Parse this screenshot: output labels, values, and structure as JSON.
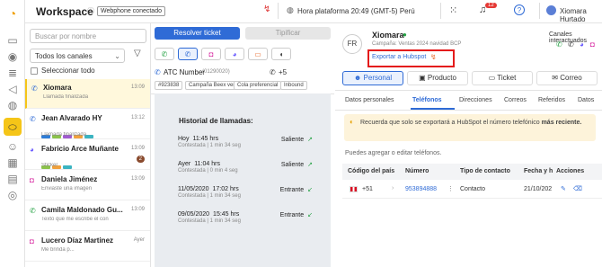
{
  "header": {
    "title": "Workspace",
    "status_badge": "Webphone conectado",
    "clock": "Hora plataforma 20:49 (GMT-5) Perú",
    "notifications_count": "12",
    "user_name": "Xiomara Hurtado"
  },
  "sidebar": {
    "search_placeholder": "Buscar por nombre",
    "channel_filter": "Todos los canales",
    "select_all": "Seleccionar todo",
    "conversations": [
      {
        "name": "Xiomara",
        "preview": "Llamada finalizada",
        "time": "13:09",
        "channel": "phone",
        "tags": [],
        "unread": ""
      },
      {
        "name": "Jean Alvarado HY",
        "preview": "Llamada finalizada",
        "time": "13:12",
        "channel": "phone",
        "tags": [
          "#2e7dd7",
          "#8bc34a",
          "#a05bd0",
          "#f0a13c",
          "#3bb4c1"
        ],
        "unread": ""
      },
      {
        "name": "Fabricio Arce Muñante",
        "preview": "Sticker",
        "time": "13:09",
        "channel": "messenger",
        "tags": [
          "#8bc34a",
          "#f0a13c",
          "#3bb4c1"
        ],
        "unread": "2"
      },
      {
        "name": "Daniela Jiménez",
        "preview": "Enviaste una imagen",
        "time": "13:09",
        "channel": "instagram",
        "tags": [],
        "unread": ""
      },
      {
        "name": "Camila Maldonado Gu...",
        "preview": "Texto que me escribe el con",
        "time": "13:09",
        "channel": "whatsapp",
        "tags": [],
        "unread": ""
      },
      {
        "name": "Lucero Díaz Martinez",
        "preview": "Me brinda p...",
        "time": "Ayer",
        "channel": "instagram",
        "tags": [],
        "unread": ""
      }
    ]
  },
  "middle": {
    "resolve_button": "Resolver ticket",
    "tag_button": "Tipificar",
    "line_label": "ATC Number",
    "line_number": "(01290020)",
    "line_phone": "+5",
    "chips": [
      "#923838",
      "Campaña Beex ventas",
      "Cola preferencial",
      "Inbound"
    ],
    "history_title": "Historial de llamadas:",
    "calls": [
      {
        "date": "Hoy",
        "time": "11:45 hrs",
        "detail": "Contestada | 1 min 34 seg",
        "direction": "Saliente",
        "arrow": "↗"
      },
      {
        "date": "Ayer",
        "time": "11:04 hrs",
        "detail": "Contestada | 0 min 4 seg",
        "direction": "Saliente",
        "arrow": "↗"
      },
      {
        "date": "11/05/2020",
        "time": "17:02 hrs",
        "detail": "Contestada | 1 min 34 seg",
        "direction": "Entrante",
        "arrow": "↙"
      },
      {
        "date": "09/05/2020",
        "time": "15:45 hrs",
        "detail": "Contestada | 1 min 34 seg",
        "direction": "Entrante",
        "arrow": "↙"
      }
    ]
  },
  "contact": {
    "initials": "FR",
    "name": "Xiomara",
    "campaign": "Campaña: Ventas 2024 navidad BCP",
    "hubspot_link": "Exportar a Hubspot",
    "channels_title": "Canales interactuados",
    "tabs": [
      "Personal",
      "Producto",
      "Ticket",
      "Correo"
    ],
    "subtabs": [
      "Datos personales",
      "Teléfonos",
      "Direcciones",
      "Correos",
      "Referidos",
      "Datos"
    ],
    "notice_text": "Recuerda que solo se exportará a HubSpot el número telefónico ",
    "notice_bold": "más reciente.",
    "add_phone_hint": "Puedes agregar o editar teléfonos.",
    "table_headers": [
      "Código del país",
      "Número",
      "Tipo de contacto",
      "Fecha y h",
      "Acciones"
    ],
    "phone_row": {
      "code": "+51",
      "number": "953894888",
      "type": "Contacto",
      "date": "21/10/202"
    }
  },
  "colors": {
    "accent_blue": "#2f6bd6",
    "highlight_red": "#e41b1b",
    "rail_active": "#f5c518",
    "whatsapp": "#25a244",
    "instagram": "#d6249f",
    "messenger": "#6b5cff",
    "notice_bg": "#fdf3da"
  }
}
